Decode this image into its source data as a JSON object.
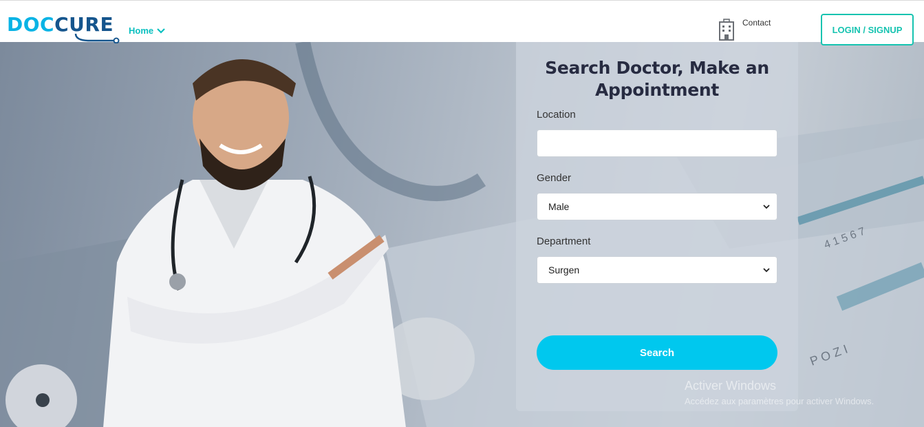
{
  "brand": {
    "logo_part1": "DOC",
    "logo_part2": "CURE"
  },
  "nav": {
    "home_label": "Home",
    "contact_label": "Contact",
    "login_label": "LOGIN / SIGNUP"
  },
  "search_form": {
    "title": "Search Doctor, Make an Appointment",
    "location_label": "Location",
    "location_value": "",
    "gender_label": "Gender",
    "gender_value": "Male",
    "department_label": "Department",
    "department_value": "Surgen",
    "search_label": "Search"
  },
  "watermark": {
    "title": "Activer Windows",
    "subtitle": "Accédez aux paramètres pour activer Windows."
  },
  "colors": {
    "accent": "#00c8ee",
    "teal": "#15c3b0",
    "brand_blue": "#15558d",
    "title_text": "#272b41"
  },
  "icons": [
    "stethoscope-icon",
    "chevron-down-icon",
    "hospital-building-icon",
    "select-caret-icon"
  ]
}
